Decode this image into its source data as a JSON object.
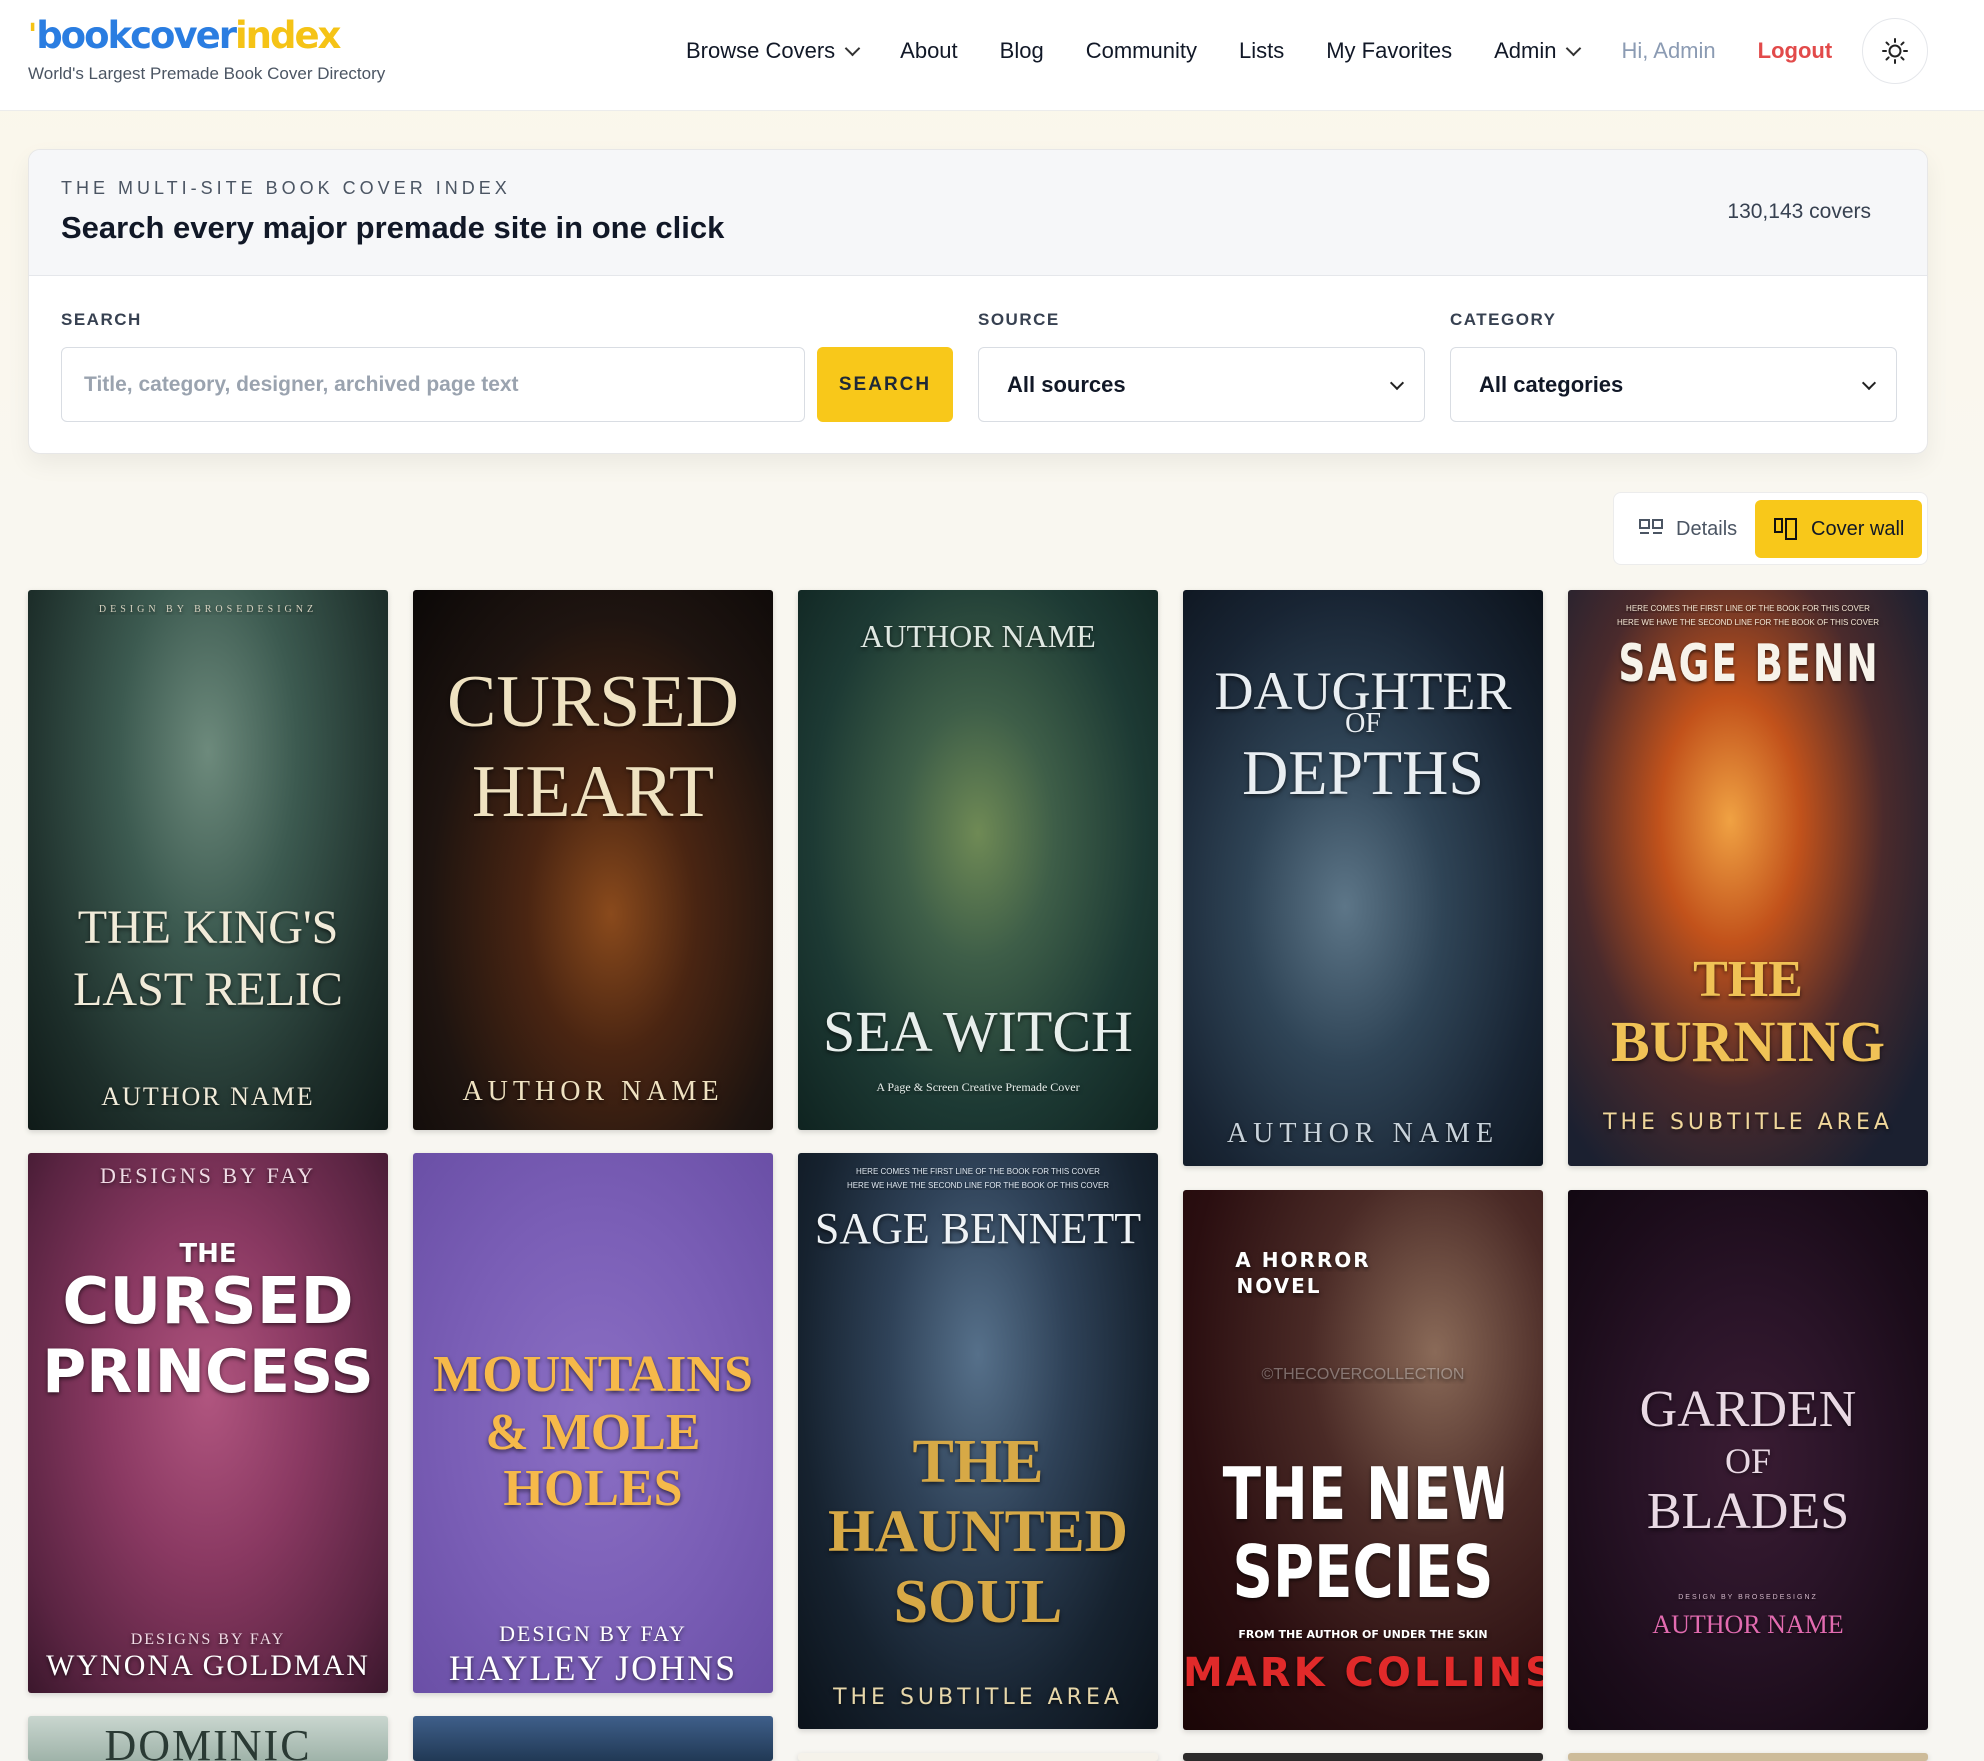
{
  "brand": {
    "logo_part1": "book",
    "logo_part2": "cover",
    "logo_part3": "index",
    "tagline": "World's Largest Premade Book Cover Directory"
  },
  "nav": {
    "browse": "Browse Covers",
    "about": "About",
    "blog": "Blog",
    "community": "Community",
    "lists": "Lists",
    "favorites": "My Favorites",
    "admin": "Admin",
    "greeting": "Hi, Admin",
    "logout": "Logout",
    "theme_icon": "sun-icon"
  },
  "hero": {
    "eyebrow": "THE MULTI-SITE BOOK COVER INDEX",
    "title": "Search every major premade site in one click",
    "count": "130,143 covers"
  },
  "search": {
    "label": "SEARCH",
    "placeholder": "Title, category, designer, archived page text",
    "value": "",
    "button": "SEARCH"
  },
  "source": {
    "label": "SOURCE",
    "selected": "All sources"
  },
  "category": {
    "label": "CATEGORY",
    "selected": "All categories"
  },
  "view": {
    "details": "Details",
    "wall": "Cover wall",
    "active": "wall"
  },
  "covers": [
    {
      "lines": [
        "DESIGN BY BROSEDESIGNZ",
        "THE KING'S",
        "LAST RELIC",
        "AUTHOR NAME"
      ]
    },
    {
      "lines": [
        "CURSED",
        "HEART",
        "AUTHOR NAME"
      ]
    },
    {
      "lines": [
        "AUTHOR NAME",
        "SEA WITCH",
        "A Page & Screen Creative Premade Cover"
      ]
    },
    {
      "lines": [
        "DAUGHTER",
        "OF",
        "DEPTHS",
        "AUTHOR NAME"
      ]
    },
    {
      "lines": [
        "HERE COMES THE FIRST LINE OF THE BOOK FOR THIS COVER",
        "HERE WE HAVE THE SECOND LINE FOR THE BOOK OF THIS COVER",
        "SAGE BENNETT",
        "THE",
        "BURNING",
        "THE SUBTITLE AREA"
      ]
    },
    {
      "lines": [
        "DESIGNS BY FAY",
        "THE",
        "CURSED",
        "PRINCESS",
        "DESIGNS BY FAY",
        "WYNONA GOLDMAN"
      ]
    },
    {
      "lines": [
        "MOUNTAINS",
        "& MOLE",
        "HOLES",
        "DESIGN BY FAY",
        "HAYLEY JOHNS"
      ]
    },
    {
      "lines": [
        "HERE COMES THE FIRST LINE OF THE BOOK FOR THIS COVER",
        "HERE WE HAVE THE SECOND LINE FOR THE BOOK OF THIS COVER",
        "SAGE BENNETT",
        "THE",
        "HAUNTED",
        "SOUL",
        "THE SUBTITLE AREA"
      ]
    },
    {
      "lines": [
        "A HORROR",
        "NOVEL",
        "©THECOVERCOLLECTION",
        "THE NEW",
        "SPECIES",
        "FROM THE AUTHOR OF UNDER THE SKIN",
        "MARK COLLINS"
      ]
    },
    {
      "lines": [
        "GARDEN",
        "OF",
        "BLADES",
        "DESIGN BY BROSEDESIGNZ",
        "AUTHOR NAME"
      ]
    },
    {
      "lines": [
        "DOMINIC"
      ]
    },
    {
      "lines": []
    }
  ]
}
